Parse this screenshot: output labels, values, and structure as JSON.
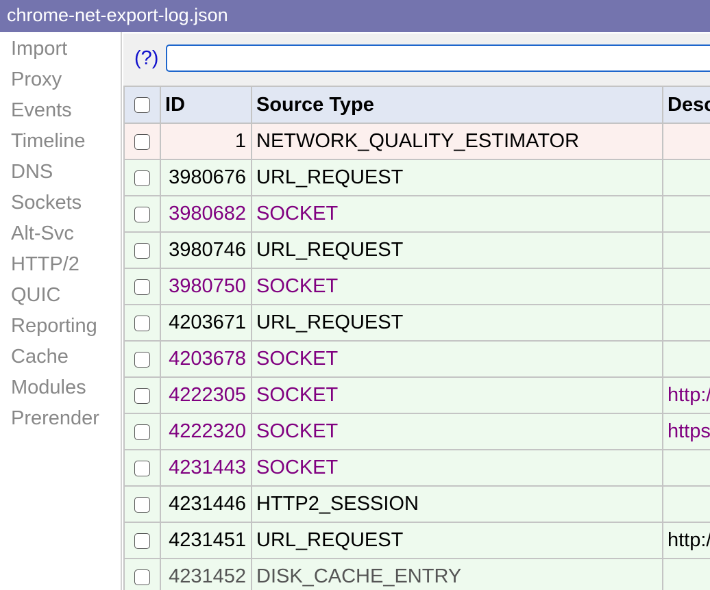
{
  "window": {
    "title": "chrome-net-export-log.json"
  },
  "tabs": [
    {
      "id": "import",
      "label": "Import"
    },
    {
      "id": "proxy",
      "label": "Proxy"
    },
    {
      "id": "events",
      "label": "Events"
    },
    {
      "id": "timeline",
      "label": "Timeline"
    },
    {
      "id": "dns",
      "label": "DNS"
    },
    {
      "id": "sockets",
      "label": "Sockets"
    },
    {
      "id": "alt-svc",
      "label": "Alt-Svc"
    },
    {
      "id": "http2",
      "label": "HTTP/2"
    },
    {
      "id": "quic",
      "label": "QUIC"
    },
    {
      "id": "reporting",
      "label": "Reporting"
    },
    {
      "id": "cache",
      "label": "Cache"
    },
    {
      "id": "modules",
      "label": "Modules"
    },
    {
      "id": "prerender",
      "label": "Prerender"
    }
  ],
  "filter": {
    "help_label": "(?)",
    "value": "",
    "placeholder": ""
  },
  "table": {
    "headers": {
      "id": "ID",
      "source_type": "Source Type",
      "description": "Desc"
    },
    "rows": [
      {
        "id": "1",
        "source_type": "NETWORK_QUALITY_ESTIMATOR",
        "description": "",
        "bg": "pink",
        "color": "black"
      },
      {
        "id": "3980676",
        "source_type": "URL_REQUEST",
        "description": "",
        "bg": "green",
        "color": "black"
      },
      {
        "id": "3980682",
        "source_type": "SOCKET",
        "description": "",
        "bg": "green",
        "color": "purple"
      },
      {
        "id": "3980746",
        "source_type": "URL_REQUEST",
        "description": "",
        "bg": "green",
        "color": "black"
      },
      {
        "id": "3980750",
        "source_type": "SOCKET",
        "description": "",
        "bg": "green",
        "color": "purple"
      },
      {
        "id": "4203671",
        "source_type": "URL_REQUEST",
        "description": "",
        "bg": "green",
        "color": "black"
      },
      {
        "id": "4203678",
        "source_type": "SOCKET",
        "description": "",
        "bg": "green",
        "color": "purple"
      },
      {
        "id": "4222305",
        "source_type": "SOCKET",
        "description": "http:/",
        "bg": "green",
        "color": "purple"
      },
      {
        "id": "4222320",
        "source_type": "SOCKET",
        "description": "https",
        "bg": "green",
        "color": "purple"
      },
      {
        "id": "4231443",
        "source_type": "SOCKET",
        "description": "",
        "bg": "green",
        "color": "purple"
      },
      {
        "id": "4231446",
        "source_type": "HTTP2_SESSION",
        "description": "",
        "bg": "green",
        "color": "black"
      },
      {
        "id": "4231451",
        "source_type": "URL_REQUEST",
        "description": "http:/",
        "bg": "green",
        "color": "black"
      },
      {
        "id": "4231452",
        "source_type": "DISK_CACHE_ENTRY",
        "description": "",
        "bg": "green",
        "color": "gray"
      }
    ]
  },
  "colors": {
    "titlebar_bg": "#7474ae",
    "header_bg": "#e1e7f3",
    "row_pink_bg": "#fcf0ee",
    "row_green_bg": "#eefaee",
    "purple_text": "#800080",
    "gray_text": "#555555",
    "tab_text": "#888888",
    "filter_border": "#1e66cc"
  }
}
